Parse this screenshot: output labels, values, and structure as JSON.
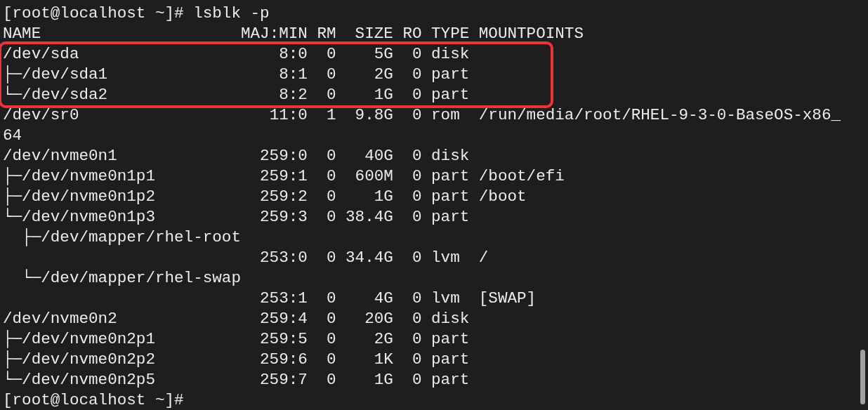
{
  "terminal": {
    "lines": [
      {
        "kind": "text",
        "text": "[root@localhost ~]# lsblk -p"
      },
      {
        "kind": "header",
        "name": "NAME",
        "maj_min": "MAJ:MIN",
        "rm": "RM",
        "size": "SIZE",
        "ro": "RO",
        "type": "TYPE",
        "mountpoint": "MOUNTPOINTS"
      },
      {
        "kind": "device",
        "highlighted": true,
        "name": "/dev/sda",
        "maj_min": "8:0",
        "rm": "0",
        "size": "5G",
        "ro": "0",
        "type": "disk"
      },
      {
        "kind": "device",
        "highlighted": true,
        "name": "├─/dev/sda1",
        "maj_min": "8:1",
        "rm": "0",
        "size": "2G",
        "ro": "0",
        "type": "part"
      },
      {
        "kind": "device",
        "highlighted": true,
        "name": "└─/dev/sda2",
        "maj_min": "8:2",
        "rm": "0",
        "size": "1G",
        "ro": "0",
        "type": "part"
      },
      {
        "kind": "device",
        "highlighted": false,
        "name": "/dev/sr0",
        "maj_min": "11:0",
        "rm": "1",
        "size": "9.8G",
        "ro": "0",
        "type": "rom",
        "mountpoint": "/run/media/root/RHEL-9-3-0-BaseOS-x86_"
      },
      {
        "kind": "text",
        "text": "64"
      },
      {
        "kind": "device",
        "highlighted": false,
        "name": "/dev/nvme0n1",
        "maj_min": "259:0",
        "rm": "0",
        "size": "40G",
        "ro": "0",
        "type": "disk"
      },
      {
        "kind": "device",
        "highlighted": false,
        "name": "├─/dev/nvme0n1p1",
        "maj_min": "259:1",
        "rm": "0",
        "size": "600M",
        "ro": "0",
        "type": "part",
        "mountpoint": "/boot/efi"
      },
      {
        "kind": "device",
        "highlighted": false,
        "name": "├─/dev/nvme0n1p2",
        "maj_min": "259:2",
        "rm": "0",
        "size": "1G",
        "ro": "0",
        "type": "part",
        "mountpoint": "/boot"
      },
      {
        "kind": "device",
        "highlighted": false,
        "name": "└─/dev/nvme0n1p3",
        "maj_min": "259:3",
        "rm": "0",
        "size": "38.4G",
        "ro": "0",
        "type": "part"
      },
      {
        "kind": "device_wrapped",
        "highlighted": false,
        "name": "  ├─/dev/mapper/rhel-root",
        "maj_min": "253:0",
        "rm": "0",
        "size": "34.4G",
        "ro": "0",
        "type": "lvm",
        "mountpoint": "/"
      },
      {
        "kind": "device_wrapped",
        "highlighted": false,
        "name": "  └─/dev/mapper/rhel-swap",
        "maj_min": "253:1",
        "rm": "0",
        "size": "4G",
        "ro": "0",
        "type": "lvm",
        "mountpoint": "[SWAP]"
      },
      {
        "kind": "device",
        "highlighted": false,
        "name": "/dev/nvme0n2",
        "maj_min": "259:4",
        "rm": "0",
        "size": "20G",
        "ro": "0",
        "type": "disk"
      },
      {
        "kind": "device",
        "highlighted": false,
        "name": "├─/dev/nvme0n2p1",
        "maj_min": "259:5",
        "rm": "0",
        "size": "2G",
        "ro": "0",
        "type": "part"
      },
      {
        "kind": "device",
        "highlighted": false,
        "name": "├─/dev/nvme0n2p2",
        "maj_min": "259:6",
        "rm": "0",
        "size": "1K",
        "ro": "0",
        "type": "part"
      },
      {
        "kind": "device",
        "highlighted": false,
        "name": "└─/dev/nvme0n2p5",
        "maj_min": "259:7",
        "rm": "0",
        "size": "1G",
        "ro": "0",
        "type": "part"
      },
      {
        "kind": "text",
        "text": "[root@localhost ~]#"
      }
    ]
  }
}
